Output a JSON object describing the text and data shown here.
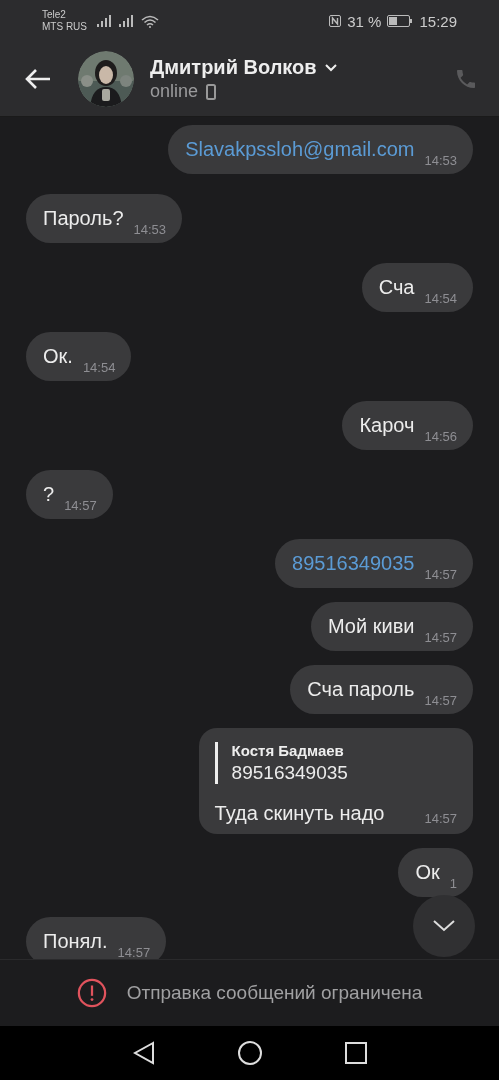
{
  "status_bar": {
    "carrier_1": "Tele2",
    "carrier_2": "MTS RUS",
    "battery_percent": "31 %",
    "time": "15:29"
  },
  "header": {
    "name": "Дмитрий Волков",
    "status": "online"
  },
  "messages": [
    {
      "kind": "text",
      "outgoing": true,
      "text": "Slavakpssloh@gmail.com",
      "link": true,
      "time": "14:53"
    },
    {
      "kind": "text",
      "outgoing": false,
      "text": "Пароль?",
      "link": false,
      "time": "14:53"
    },
    {
      "kind": "text",
      "outgoing": true,
      "text": "Сча",
      "link": false,
      "time": "14:54"
    },
    {
      "kind": "text",
      "outgoing": false,
      "text": "Ок.",
      "link": false,
      "time": "14:54"
    },
    {
      "kind": "text",
      "outgoing": true,
      "text": "Кароч",
      "link": false,
      "time": "14:56"
    },
    {
      "kind": "text",
      "outgoing": false,
      "text": "?",
      "link": false,
      "time": "14:57"
    },
    {
      "kind": "text",
      "outgoing": true,
      "text": "89516349035",
      "link": true,
      "time": "14:57"
    },
    {
      "kind": "text",
      "outgoing": true,
      "text": "Мой киви",
      "link": false,
      "time": "14:57"
    },
    {
      "kind": "text",
      "outgoing": true,
      "text": "Сча пароль",
      "link": false,
      "time": "14:57"
    },
    {
      "kind": "reply",
      "outgoing": true,
      "quote_author": "Костя Бадмаев",
      "quote_text": "89516349035",
      "text": "Туда скинуть надо",
      "time": "14:57"
    },
    {
      "kind": "text",
      "outgoing": true,
      "text": "Ок",
      "link": false,
      "time": "1"
    },
    {
      "kind": "text",
      "outgoing": false,
      "text": "Понял.",
      "link": false,
      "time": "14:57"
    }
  ],
  "notice": "Отправка сообщений ограничена"
}
